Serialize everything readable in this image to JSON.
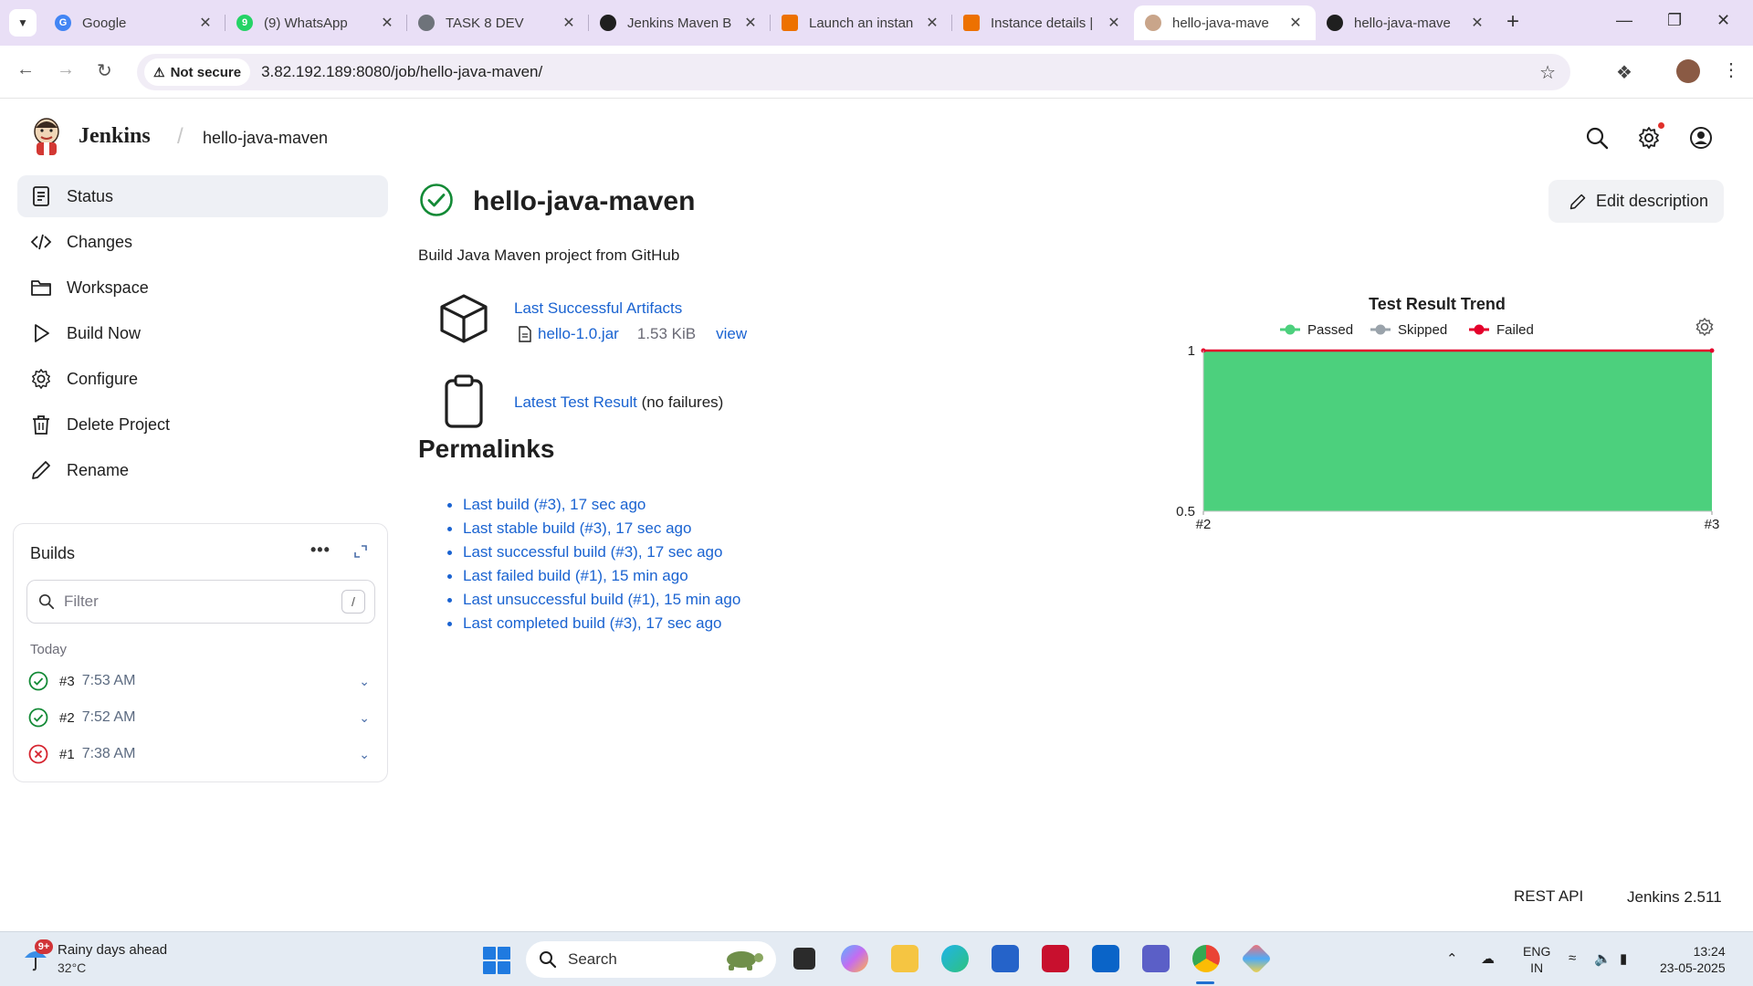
{
  "browser": {
    "tabs": [
      {
        "title": "Google",
        "icon": "google-icon",
        "color": "#4285f4"
      },
      {
        "title": "(9) WhatsApp",
        "icon": "whatsapp-icon",
        "color": "#25d366"
      },
      {
        "title": "TASK 8 DEV",
        "icon": "globe-icon",
        "color": "#5f6368"
      },
      {
        "title": "Jenkins Maven B",
        "icon": "openai-icon",
        "color": "#1f1f1f"
      },
      {
        "title": "Launch an instan",
        "icon": "aws-icon",
        "color": "#ed7100"
      },
      {
        "title": "Instance details |",
        "icon": "aws-icon",
        "color": "#ed7100"
      },
      {
        "title": "hello-java-mave",
        "icon": "jenkins-icon",
        "color": "#d33833",
        "active": true
      },
      {
        "title": "hello-java-mave",
        "icon": "github-icon",
        "color": "#1f1f1f"
      }
    ],
    "security_label": "Not secure",
    "url": "3.82.192.189:8080/job/hello-java-maven/"
  },
  "jenkins": {
    "brand": "Jenkins",
    "breadcrumb": "hello-java-maven",
    "header_icons": [
      "search-icon",
      "gear-icon",
      "user-icon"
    ]
  },
  "sidenav": {
    "items": [
      {
        "label": "Status",
        "icon": "status-icon",
        "active": true
      },
      {
        "label": "Changes",
        "icon": "code-icon"
      },
      {
        "label": "Workspace",
        "icon": "folder-icon"
      },
      {
        "label": "Build Now",
        "icon": "play-icon"
      },
      {
        "label": "Configure",
        "icon": "gear-icon"
      },
      {
        "label": "Delete Project",
        "icon": "trash-icon"
      },
      {
        "label": "Rename",
        "icon": "pencil-icon"
      }
    ]
  },
  "builds": {
    "title": "Builds",
    "more": "•••",
    "filter_placeholder": "Filter",
    "filter_shortcut": "/",
    "group_label": "Today",
    "items": [
      {
        "number": "#3",
        "time": "7:53 AM",
        "status": "success"
      },
      {
        "number": "#2",
        "time": "7:52 AM",
        "status": "success"
      },
      {
        "number": "#1",
        "time": "7:38 AM",
        "status": "failed"
      }
    ]
  },
  "main": {
    "title": "hello-java-maven",
    "status": "success",
    "edit_description": "Edit description",
    "description": "Build Java Maven project from GitHub",
    "artifacts": {
      "link": "Last Successful Artifacts",
      "file": "hello-1.0.jar",
      "size": "1.53 KiB",
      "view": "view"
    },
    "test_result": {
      "link": "Latest Test Result",
      "suffix": "(no failures)"
    },
    "permalinks_title": "Permalinks",
    "permalinks": [
      "Last build (#3), 17 sec ago",
      "Last stable build (#3), 17 sec ago",
      "Last successful build (#3), 17 sec ago",
      "Last failed build (#1), 15 min ago",
      "Last unsuccessful build (#1), 15 min ago",
      "Last completed build (#3), 17 sec ago"
    ]
  },
  "chart_data": {
    "type": "area",
    "title": "Test Result Trend",
    "x": [
      "#2",
      "#3"
    ],
    "series": [
      {
        "name": "Passed",
        "values": [
          1,
          1
        ],
        "color": "#4cd07d"
      },
      {
        "name": "Skipped",
        "values": [
          0,
          0
        ],
        "color": "#9aa3ab"
      },
      {
        "name": "Failed",
        "values": [
          0,
          0
        ],
        "color": "#e4002b"
      }
    ],
    "ylim": [
      0.5,
      1
    ],
    "yticks": [
      "0.5",
      "1"
    ],
    "legend": "top"
  },
  "footer": {
    "rest_api": "REST API",
    "version": "Jenkins 2.511"
  },
  "taskbar": {
    "weather_badge": "9+",
    "weather_title": "Rainy days ahead",
    "weather_temp": "32°C",
    "search_placeholder": "Search",
    "language": "ENG",
    "region": "IN",
    "time": "13:24",
    "date": "23-05-2025"
  }
}
